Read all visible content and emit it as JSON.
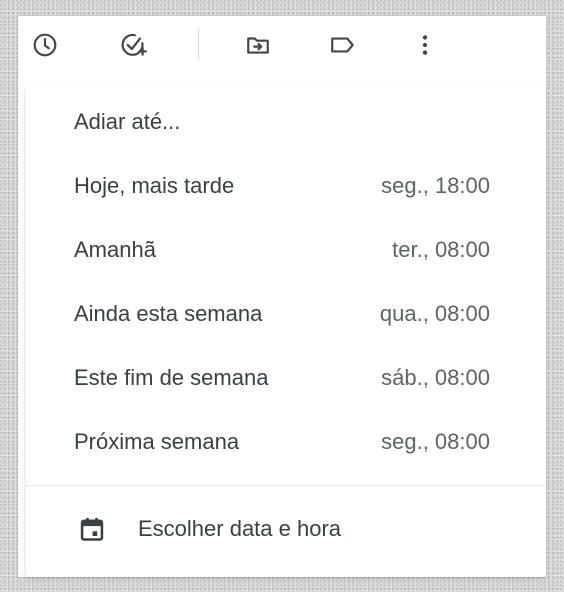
{
  "toolbar": {
    "icons": [
      "clock-icon",
      "add-task-icon",
      "move-to-folder-icon",
      "label-icon",
      "more-vert-icon"
    ]
  },
  "snooze_menu": {
    "title": "Adiar até...",
    "options": [
      {
        "label": "Hoje, mais tarde",
        "time": "seg., 18:00"
      },
      {
        "label": "Amanhã",
        "time": "ter., 08:00"
      },
      {
        "label": "Ainda esta semana",
        "time": "qua., 08:00"
      },
      {
        "label": "Este fim de semana",
        "time": "sáb., 08:00"
      },
      {
        "label": "Próxima semana",
        "time": "seg., 08:00"
      }
    ],
    "pick_date": {
      "label": "Escolher data e hora",
      "icon": "calendar-icon"
    }
  },
  "colors": {
    "text_primary": "#3c4043",
    "text_secondary": "#5f6368",
    "icon": "#444746",
    "divider": "#e8eaed"
  }
}
